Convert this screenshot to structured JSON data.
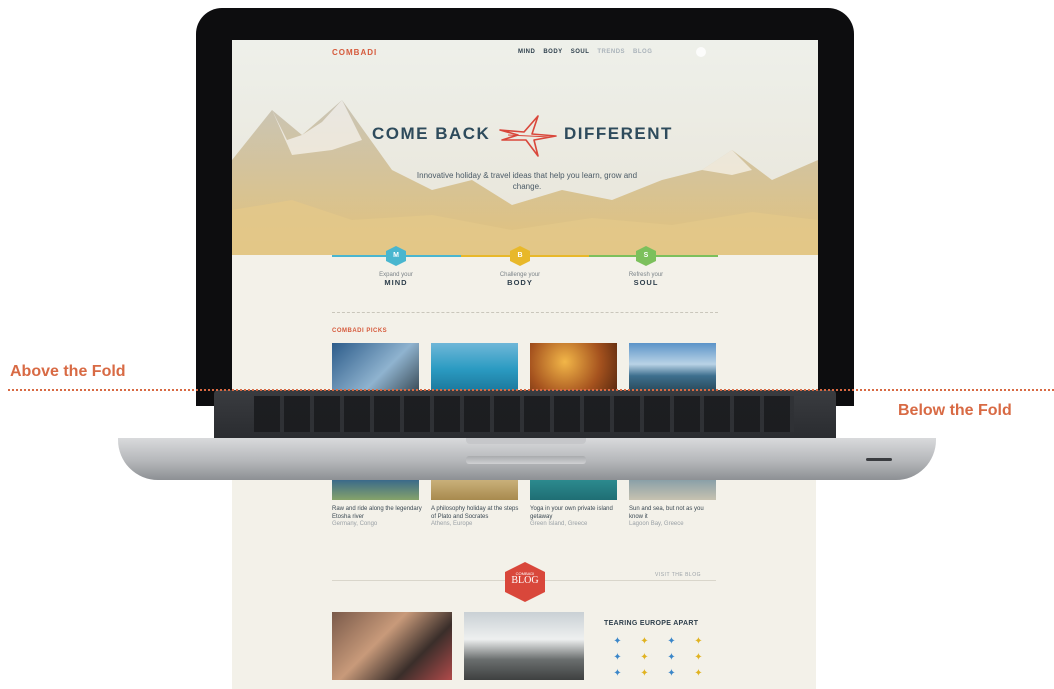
{
  "site": {
    "logo": "COMBADI",
    "nav": [
      "MIND",
      "BODY",
      "SOUL",
      "TRENDS",
      "BLOG"
    ]
  },
  "hero": {
    "title_left": "COME BACK",
    "title_right": "DIFFERENT",
    "subtitle": "Innovative holiday & travel ideas that help you learn, grow and change."
  },
  "pillars": [
    {
      "letter": "M",
      "label": "Expand your",
      "name": "MIND",
      "color": "#49b6cf"
    },
    {
      "letter": "B",
      "label": "Challenge your",
      "name": "BODY",
      "color": "#e8b82a"
    },
    {
      "letter": "S",
      "label": "Refresh your",
      "name": "SOUL",
      "color": "#7cc05c"
    }
  ],
  "picks": {
    "title": "COMBADI PICKS",
    "captions": [
      {
        "text": "Raw and ride along the legendary Etosha river",
        "loc": "Germany, Congo"
      },
      {
        "text": "A philosophy holiday at the steps of Plato and Socrates",
        "loc": "Athens, Europe"
      },
      {
        "text": "Yoga in your own private island getaway",
        "loc": "Green Island, Greece"
      },
      {
        "text": "Sun and sea, but not as you know it",
        "loc": "Lagoon Bay, Greece"
      }
    ]
  },
  "fold": {
    "above": "Above the Fold",
    "below": "Below the Fold"
  },
  "blog": {
    "badge_small": "COMBADI",
    "badge_big": "BLOG",
    "visit": "VISIT THE BLOG",
    "team_title": "TEARING EUROPE APART"
  },
  "colors": {
    "brand": "#d65a3c",
    "navy": "#2e4b5c",
    "fold": "#d86a44"
  }
}
